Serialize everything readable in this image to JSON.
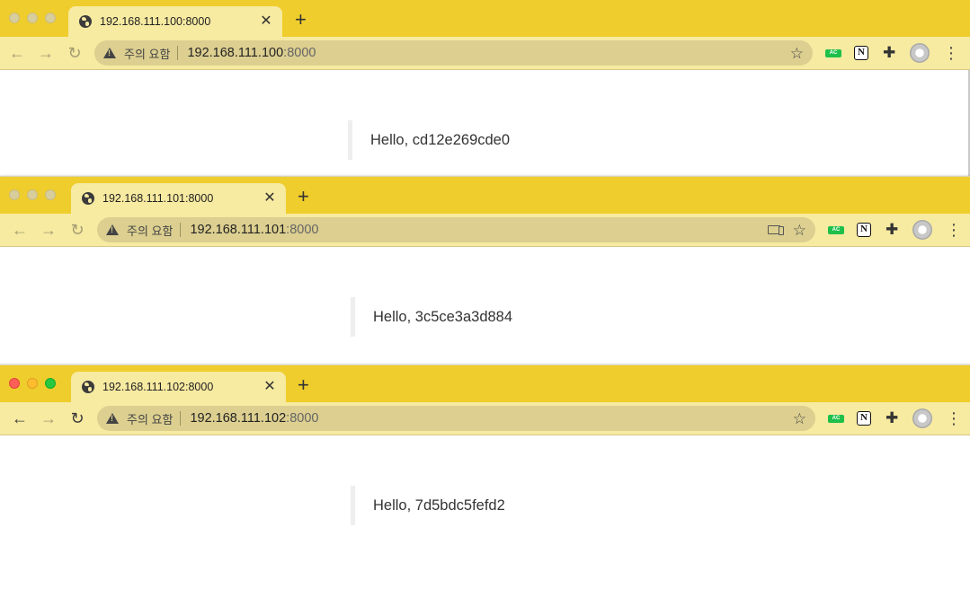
{
  "windows": [
    {
      "tab_title": "192.168.111.100:8000",
      "warning_text": "주의 요함",
      "url_host": "192.168.111.100",
      "url_port": ":8000",
      "hello": "Hello, cd12e269cde0",
      "active": false
    },
    {
      "tab_title": "192.168.111.101:8000",
      "warning_text": "주의 요함",
      "url_host": "192.168.111.101",
      "url_port": ":8000",
      "hello": "Hello, 3c5ce3a3d884",
      "active": false
    },
    {
      "tab_title": "192.168.111.102:8000",
      "warning_text": "주의 요함",
      "url_host": "192.168.111.102",
      "url_port": ":8000",
      "hello": "Hello, 7d5bdc5fefd2",
      "active": true
    }
  ],
  "icons": {
    "back": "←",
    "forward": "→",
    "reload": "↻",
    "close": "✕",
    "new_tab": "+",
    "star": "☆",
    "puzzle": "✚",
    "menu": "⋮",
    "notion": "N",
    "ac_extension": "AC"
  },
  "colors": {
    "tabstrip": "#efcd2c",
    "toolbar": "#f7eaa1",
    "omnibox": "#dccf90",
    "ac_extension": "#1ec04a"
  }
}
